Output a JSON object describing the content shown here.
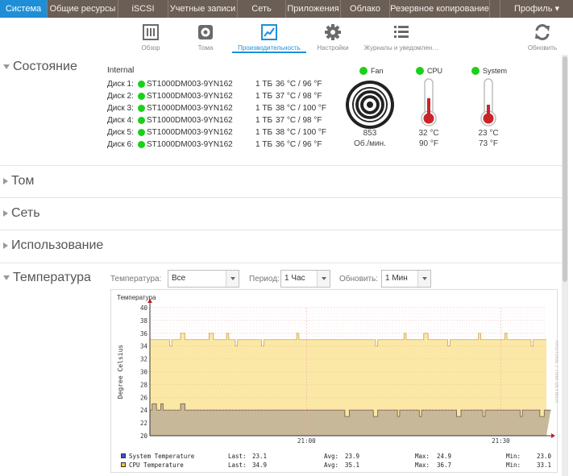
{
  "nav": {
    "tabs": [
      "Система",
      "Общие ресурсы",
      "iSCSI",
      "Учетные записи",
      "Сеть",
      "Приложения",
      "Облако",
      "Резервное копирование"
    ],
    "active_index": 0,
    "profile": "Профиль ▾"
  },
  "subnav": {
    "overview": "Обзор",
    "volumes": "Тома",
    "performance": "Производительность",
    "settings": "Настройки",
    "logs": "Журналы и уведомлен…",
    "refresh": "Обновить"
  },
  "status": {
    "title": "Состояние",
    "internal_label": "Internal",
    "disks": [
      {
        "label": "Диск 1:",
        "model": "ST1000DM003-9YN162",
        "size": "1 ТБ",
        "temp": "36 °C / 96 °F"
      },
      {
        "label": "Диск 2:",
        "model": "ST1000DM003-9YN162",
        "size": "1 ТБ",
        "temp": "37 °C / 98 °F"
      },
      {
        "label": "Диск 3:",
        "model": "ST1000DM003-9YN162",
        "size": "1 ТБ",
        "temp": "38 °C / 100 °F"
      },
      {
        "label": "Диск 4:",
        "model": "ST1000DM003-9YN162",
        "size": "1 ТБ",
        "temp": "37 °C / 98 °F"
      },
      {
        "label": "Диск 5:",
        "model": "ST1000DM003-9YN162",
        "size": "1 ТБ",
        "temp": "38 °C / 100 °F"
      },
      {
        "label": "Диск 6:",
        "model": "ST1000DM003-9YN162",
        "size": "1 ТБ",
        "temp": "36 °C / 96 °F"
      }
    ],
    "fan": {
      "label": "Fan",
      "value": "853",
      "unit": "Об./мин."
    },
    "cpu": {
      "label": "CPU",
      "c": "32 °C",
      "f": "90 °F"
    },
    "system": {
      "label": "System",
      "c": "23 °C",
      "f": "73 °F"
    },
    "status_color": "#19d119"
  },
  "sections": {
    "volume": "Том",
    "network": "Сеть",
    "usage": "Использование",
    "temperature": "Температура"
  },
  "controls": {
    "temp_label": "Температура:",
    "temp_value": "Все",
    "period_label": "Период:",
    "period_value": "1 Час",
    "refresh_label": "Обновить:",
    "refresh_value": "1 Мин"
  },
  "chart_data": {
    "type": "area",
    "title": "Температура",
    "ylabel": "Degree Celsius",
    "ylim": [
      20,
      40
    ],
    "yticks": [
      20,
      22,
      24,
      26,
      28,
      30,
      32,
      34,
      36,
      38,
      40
    ],
    "xticks": [
      "21:00",
      "21:30"
    ],
    "watermark": "RRDTOOL / TOBI OETIKER",
    "series": [
      {
        "name": "CPU",
        "legend": "CPU    Temperature",
        "color": "#fbe49c",
        "values": [
          35,
          35,
          35,
          35,
          35,
          35,
          35,
          35,
          35,
          34,
          35,
          35,
          35,
          35,
          36,
          36,
          35,
          35,
          35,
          35,
          35,
          35,
          35,
          35,
          35,
          35,
          35,
          36,
          36,
          35,
          35,
          35,
          35,
          35,
          35,
          36,
          35,
          35,
          35,
          34,
          35,
          35,
          35,
          35,
          35,
          35,
          35,
          35,
          35,
          35,
          35,
          34,
          35,
          35,
          35,
          35,
          35,
          35,
          35,
          35,
          35,
          35,
          35,
          35,
          35,
          35,
          35,
          36,
          35,
          35,
          35,
          35,
          35,
          35,
          35,
          35,
          35,
          35,
          35,
          35,
          35,
          35,
          35,
          35,
          35,
          35,
          35,
          35,
          35,
          35,
          35,
          35,
          35,
          35,
          35,
          35,
          35,
          35,
          35,
          35,
          35,
          35,
          35,
          34,
          35,
          35,
          35,
          35,
          35,
          35,
          35,
          35,
          35,
          35,
          35,
          35,
          36,
          35,
          35,
          35,
          35,
          35,
          35,
          35,
          35,
          36,
          36,
          35,
          35,
          35,
          35,
          35,
          35,
          35,
          35,
          35,
          34,
          35,
          35,
          35,
          35,
          35,
          35,
          35,
          35,
          35,
          35,
          35,
          35,
          35,
          36,
          35,
          35,
          35,
          35,
          35,
          35,
          35,
          35,
          35,
          35,
          35,
          36,
          35,
          35,
          35,
          35,
          35,
          35,
          35,
          35,
          35,
          35,
          35,
          34,
          35,
          35,
          35,
          35,
          35,
          35
        ],
        "stats": {
          "last": "34.9",
          "avg": "35.1",
          "max": "36.7",
          "min": "33.1"
        }
      },
      {
        "name": "System",
        "legend": "System Temperature",
        "color": "#4a4ad0",
        "values": [
          24,
          25,
          25,
          24,
          24,
          25,
          24,
          24,
          24,
          24,
          24,
          24,
          24,
          24,
          25,
          25,
          24,
          24,
          24,
          24,
          24,
          24,
          24,
          24,
          24,
          24,
          24,
          24,
          24,
          24,
          24,
          24,
          24,
          24,
          24,
          24,
          24,
          24,
          24,
          24,
          24,
          24,
          24,
          24,
          24,
          24,
          24,
          24,
          24,
          24,
          24,
          24,
          24,
          24,
          24,
          24,
          24,
          24,
          24,
          24,
          24,
          24,
          24,
          24,
          24,
          24,
          24,
          24,
          24,
          24,
          24,
          24,
          24,
          24,
          24,
          24,
          24,
          24,
          24,
          24,
          24,
          24,
          24,
          24,
          24,
          24,
          24,
          24,
          24,
          23,
          23,
          24,
          24,
          24,
          24,
          24,
          24,
          24,
          24,
          24,
          24,
          24,
          23,
          23,
          24,
          24,
          24,
          24,
          24,
          24,
          24,
          24,
          24,
          23,
          24,
          24,
          24,
          24,
          24,
          24,
          24,
          24,
          24,
          23,
          24,
          24,
          24,
          24,
          24,
          24,
          24,
          24,
          24,
          24,
          24,
          24,
          24,
          24,
          24,
          24,
          23,
          23,
          24,
          24,
          24,
          24,
          24,
          24,
          24,
          24,
          24,
          24,
          23,
          24,
          24,
          24,
          24,
          24,
          24,
          24,
          24,
          24,
          24,
          24,
          24,
          24,
          24,
          24,
          24,
          23,
          24,
          24,
          24,
          24,
          24,
          24,
          24,
          24,
          23,
          23,
          24,
          24,
          24
        ],
        "stats": {
          "last": "23.1",
          "avg": "23.9",
          "max": "24.9",
          "min": "23.0"
        }
      }
    ],
    "stat_labels": {
      "last": "Last:",
      "avg": "Avg:",
      "max": "Max:",
      "min": "Min:"
    }
  }
}
